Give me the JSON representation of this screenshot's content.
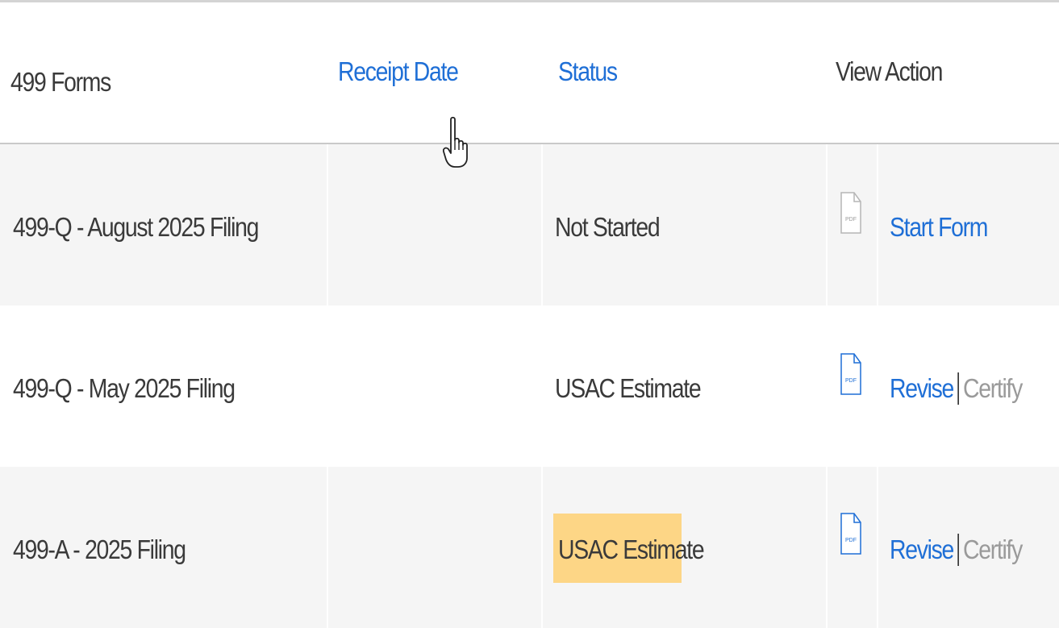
{
  "header": {
    "col_forms": "499 Forms",
    "col_receipt_date": "Receipt Date",
    "col_status": "Status",
    "col_view": "View",
    "col_action": "Action"
  },
  "rows": [
    {
      "form": "499-Q - August 2025 Filing",
      "receipt_date": "",
      "status": "Not Started",
      "pdf_icon": "pdf-file-icon-gray",
      "pdf_label": "PDF",
      "action_primary": "Start Form",
      "action_secondary": ""
    },
    {
      "form": "499-Q - May 2025 Filing",
      "receipt_date": "",
      "status": "USAC Estimate",
      "pdf_icon": "pdf-file-icon-blue",
      "pdf_label": "PDF",
      "action_primary": "Revise",
      "action_secondary": "Certify"
    },
    {
      "form": "499-A - 2025 Filing",
      "receipt_date": "",
      "status": "USAC Estimate",
      "status_highlighted": true,
      "pdf_icon": "pdf-file-icon-blue",
      "pdf_label": "PDF",
      "action_primary": "Revise",
      "action_secondary": "Certify"
    }
  ],
  "colors": {
    "link": "#1f6fd6",
    "text": "#3a3a3a",
    "disabled": "#9a9a9a",
    "row_shade": "#f5f5f5",
    "highlight": "#fdd686"
  }
}
